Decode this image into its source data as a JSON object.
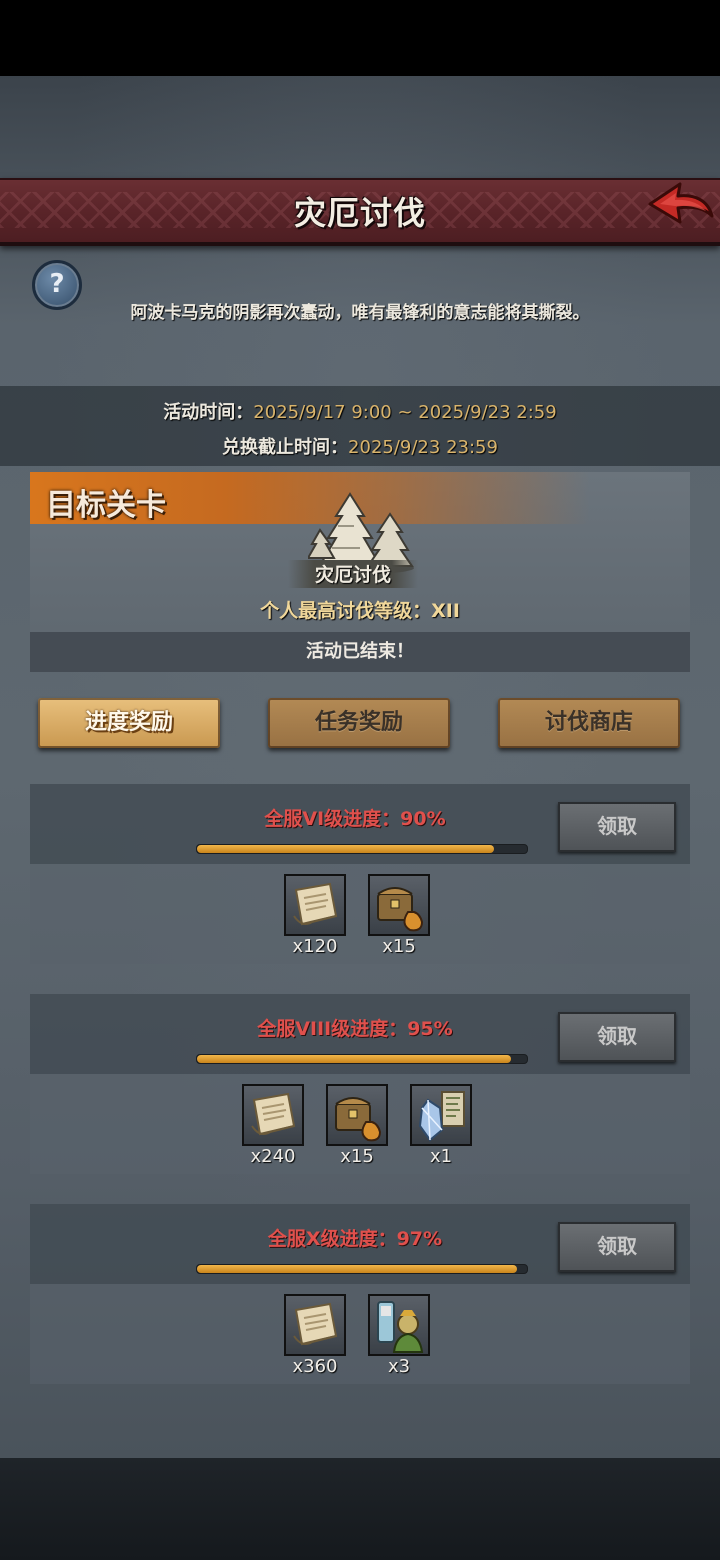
{
  "header": {
    "title": "灾厄讨伐"
  },
  "description": "阿波卡马克的阴影再次蠢动，唯有最锋利的意志能将其撕裂。",
  "times": {
    "activity_label": "活动时间：",
    "activity_value": "2025/9/17 9:00 ~ 2025/9/23 2:59",
    "exchange_label": "兑换截止时间：",
    "exchange_value": "2025/9/23 23:59"
  },
  "target": {
    "section_title": "目标关卡",
    "stage_name": "灾厄讨伐",
    "highest_level_label": "个人最高讨伐等级：",
    "highest_level_value": "XII",
    "status": "活动已结束！"
  },
  "tabs": [
    "进度奖励",
    "任务奖励",
    "讨伐商店"
  ],
  "progress": [
    {
      "title": "全服VI级进度：90%",
      "percent": 90,
      "claim_label": "领取",
      "rewards": [
        {
          "icon": "scroll-icon",
          "qty": "x120"
        },
        {
          "icon": "treasure-chest-icon",
          "qty": "x15"
        }
      ]
    },
    {
      "title": "全服VIII级进度：95%",
      "percent": 95,
      "claim_label": "领取",
      "rewards": [
        {
          "icon": "scroll-icon",
          "qty": "x240"
        },
        {
          "icon": "treasure-chest-icon",
          "qty": "x15"
        },
        {
          "icon": "crystal-icon",
          "qty": "x1"
        }
      ]
    },
    {
      "title": "全服X级进度：97%",
      "percent": 97,
      "claim_label": "领取",
      "rewards": [
        {
          "icon": "scroll-icon",
          "qty": "x360"
        },
        {
          "icon": "potion-hero-icon",
          "qty": "x3"
        }
      ]
    }
  ],
  "colors": {
    "accent_orange": "#d8761d",
    "progress_title": "#e0504c",
    "banner": "#5a2429",
    "gold_text": "#d9b46c"
  }
}
